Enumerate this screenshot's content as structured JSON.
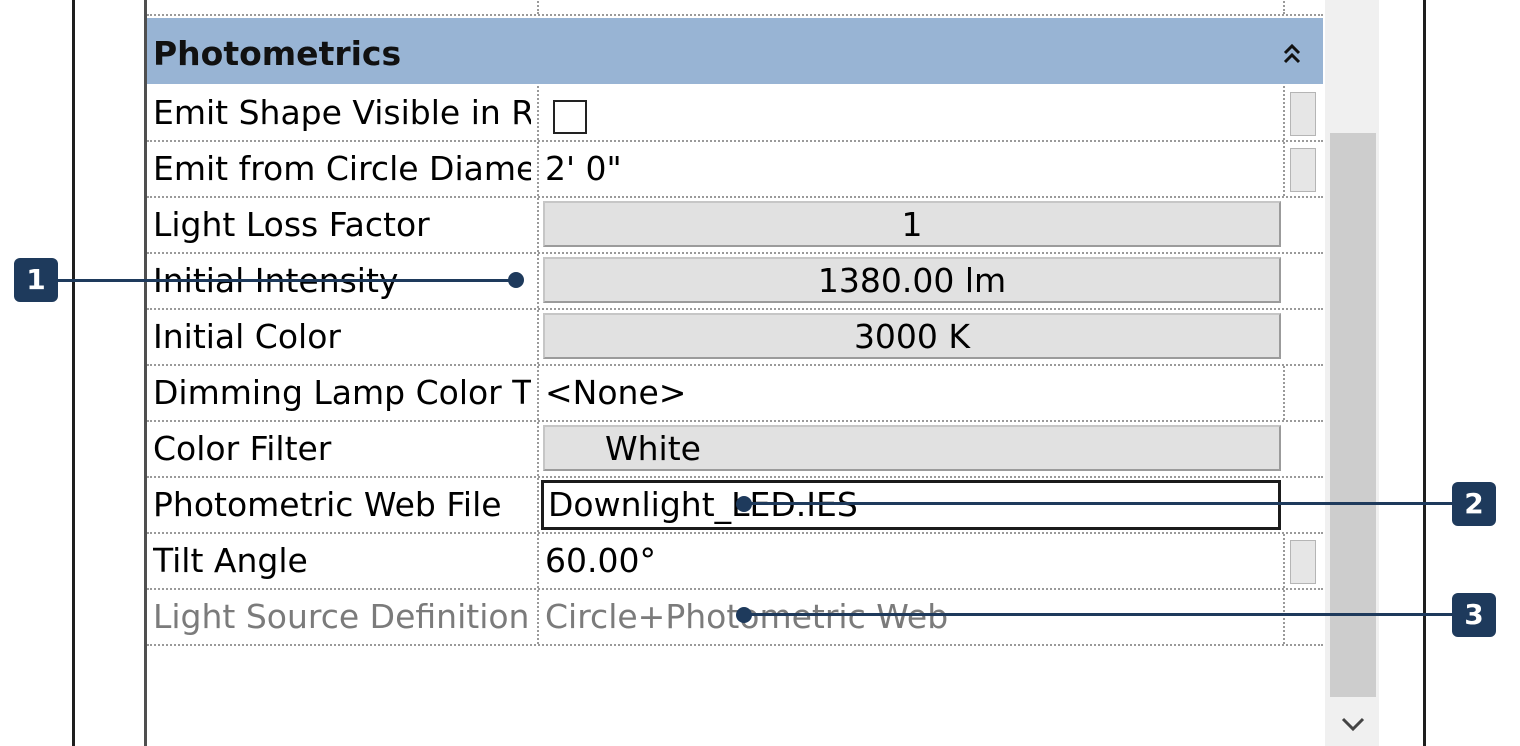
{
  "section": {
    "title": "Photometrics"
  },
  "properties": [
    {
      "label": "Emit Shape Visible in R",
      "value": ""
    },
    {
      "label": "Emit from Circle Diame",
      "value": "2'  0\""
    },
    {
      "label": "Light Loss Factor",
      "value": "1"
    },
    {
      "label": "Initial Intensity",
      "value": "1380.00 lm"
    },
    {
      "label": "Initial Color",
      "value": "3000 K"
    },
    {
      "label": "Dimming Lamp Color T",
      "value": "<None>"
    },
    {
      "label": "Color Filter",
      "value": "White"
    },
    {
      "label": "Photometric Web File",
      "value": "Downlight_LED.IES"
    },
    {
      "label": "Tilt Angle",
      "value": "60.00°"
    },
    {
      "label": "Light Source Definition",
      "value": "Circle+Photometric Web"
    }
  ],
  "callouts": [
    "1",
    "2",
    "3"
  ],
  "colors": {
    "section_header": "#98b4d4",
    "callout": "#1e3a5c",
    "disabled_text": "#7b7b7b"
  },
  "icons": {
    "collapse": "double-chevron-up-icon",
    "scroll_down": "chevron-down-icon"
  }
}
